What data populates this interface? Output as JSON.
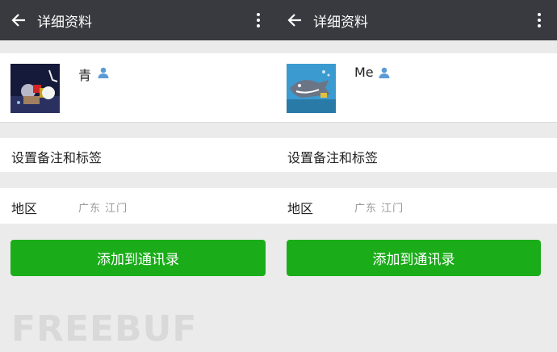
{
  "panels": [
    {
      "title": "详细资料",
      "name": "青",
      "remark_label": "设置备注和标签",
      "region_label": "地区",
      "region_value": "广东  江门",
      "add_button": "添加到通讯录"
    },
    {
      "title": "详细资料",
      "name": "Me",
      "remark_label": "设置备注和标签",
      "region_label": "地区",
      "region_value": "广东  江门",
      "add_button": "添加到通讯录"
    }
  ],
  "watermark": "FREEBUF",
  "icons": {
    "back": "back-arrow-icon",
    "more": "more-vertical-icon",
    "person": "person-icon"
  },
  "colors": {
    "topbar": "#393a3f",
    "button": "#1aad19",
    "background": "#ebebeb",
    "person_icon": "#5b9bd5"
  }
}
